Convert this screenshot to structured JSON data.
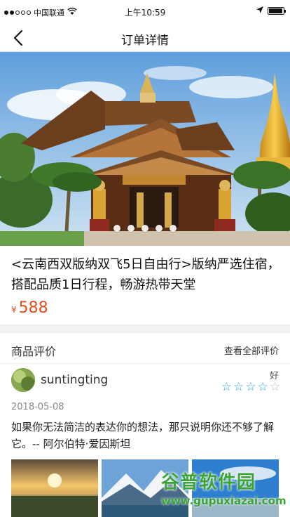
{
  "status_bar": {
    "carrier": "中国联通",
    "time": "上午10:59"
  },
  "nav": {
    "title": "订单详情"
  },
  "hero": {
    "carousel_count": 5
  },
  "product": {
    "title": "<云南西双版纳双飞5日自由行>版纳严选住宿，搭配品质1日行程，畅游热带天堂",
    "currency": "¥",
    "price": "588"
  },
  "reviews": {
    "title": "商品评价",
    "view_all": "查看全部评价",
    "item": {
      "username": "suntingting",
      "rating_label": "好",
      "rating": 4,
      "rating_max": 5,
      "date": "2018-05-08",
      "text": "如果你无法简洁的表达你的想法，那只说明你还不够了解它。-- 阿尔伯特·爱因斯坦"
    }
  },
  "watermark": {
    "top": "谷普软件园",
    "bottom": "www.gupuxiazai.com"
  },
  "colors": {
    "price": "#e74c1c",
    "star": "#2ba4d9"
  }
}
